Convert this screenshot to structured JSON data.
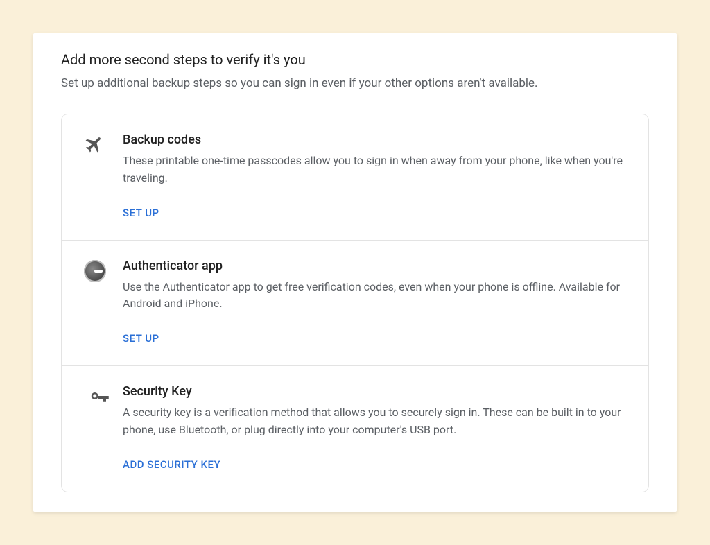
{
  "header": {
    "title": "Add more second steps to verify it's you",
    "subtitle": "Set up additional backup steps so you can sign in even if your other options aren't available."
  },
  "options": [
    {
      "icon": "airplane",
      "title": "Backup codes",
      "description": "These printable one-time passcodes allow you to sign in when away from your phone, like when you're traveling.",
      "action_label": "SET UP"
    },
    {
      "icon": "authenticator",
      "title": "Authenticator app",
      "description": "Use the Authenticator app to get free verification codes, even when your phone is offline. Available for Android and iPhone.",
      "action_label": "SET UP"
    },
    {
      "icon": "key",
      "title": "Security Key",
      "description": "A security key is a verification method that allows you to securely sign in. These can be built in to your phone, use Bluetooth, or plug directly into your computer's USB port.",
      "action_label": "ADD SECURITY KEY"
    }
  ]
}
